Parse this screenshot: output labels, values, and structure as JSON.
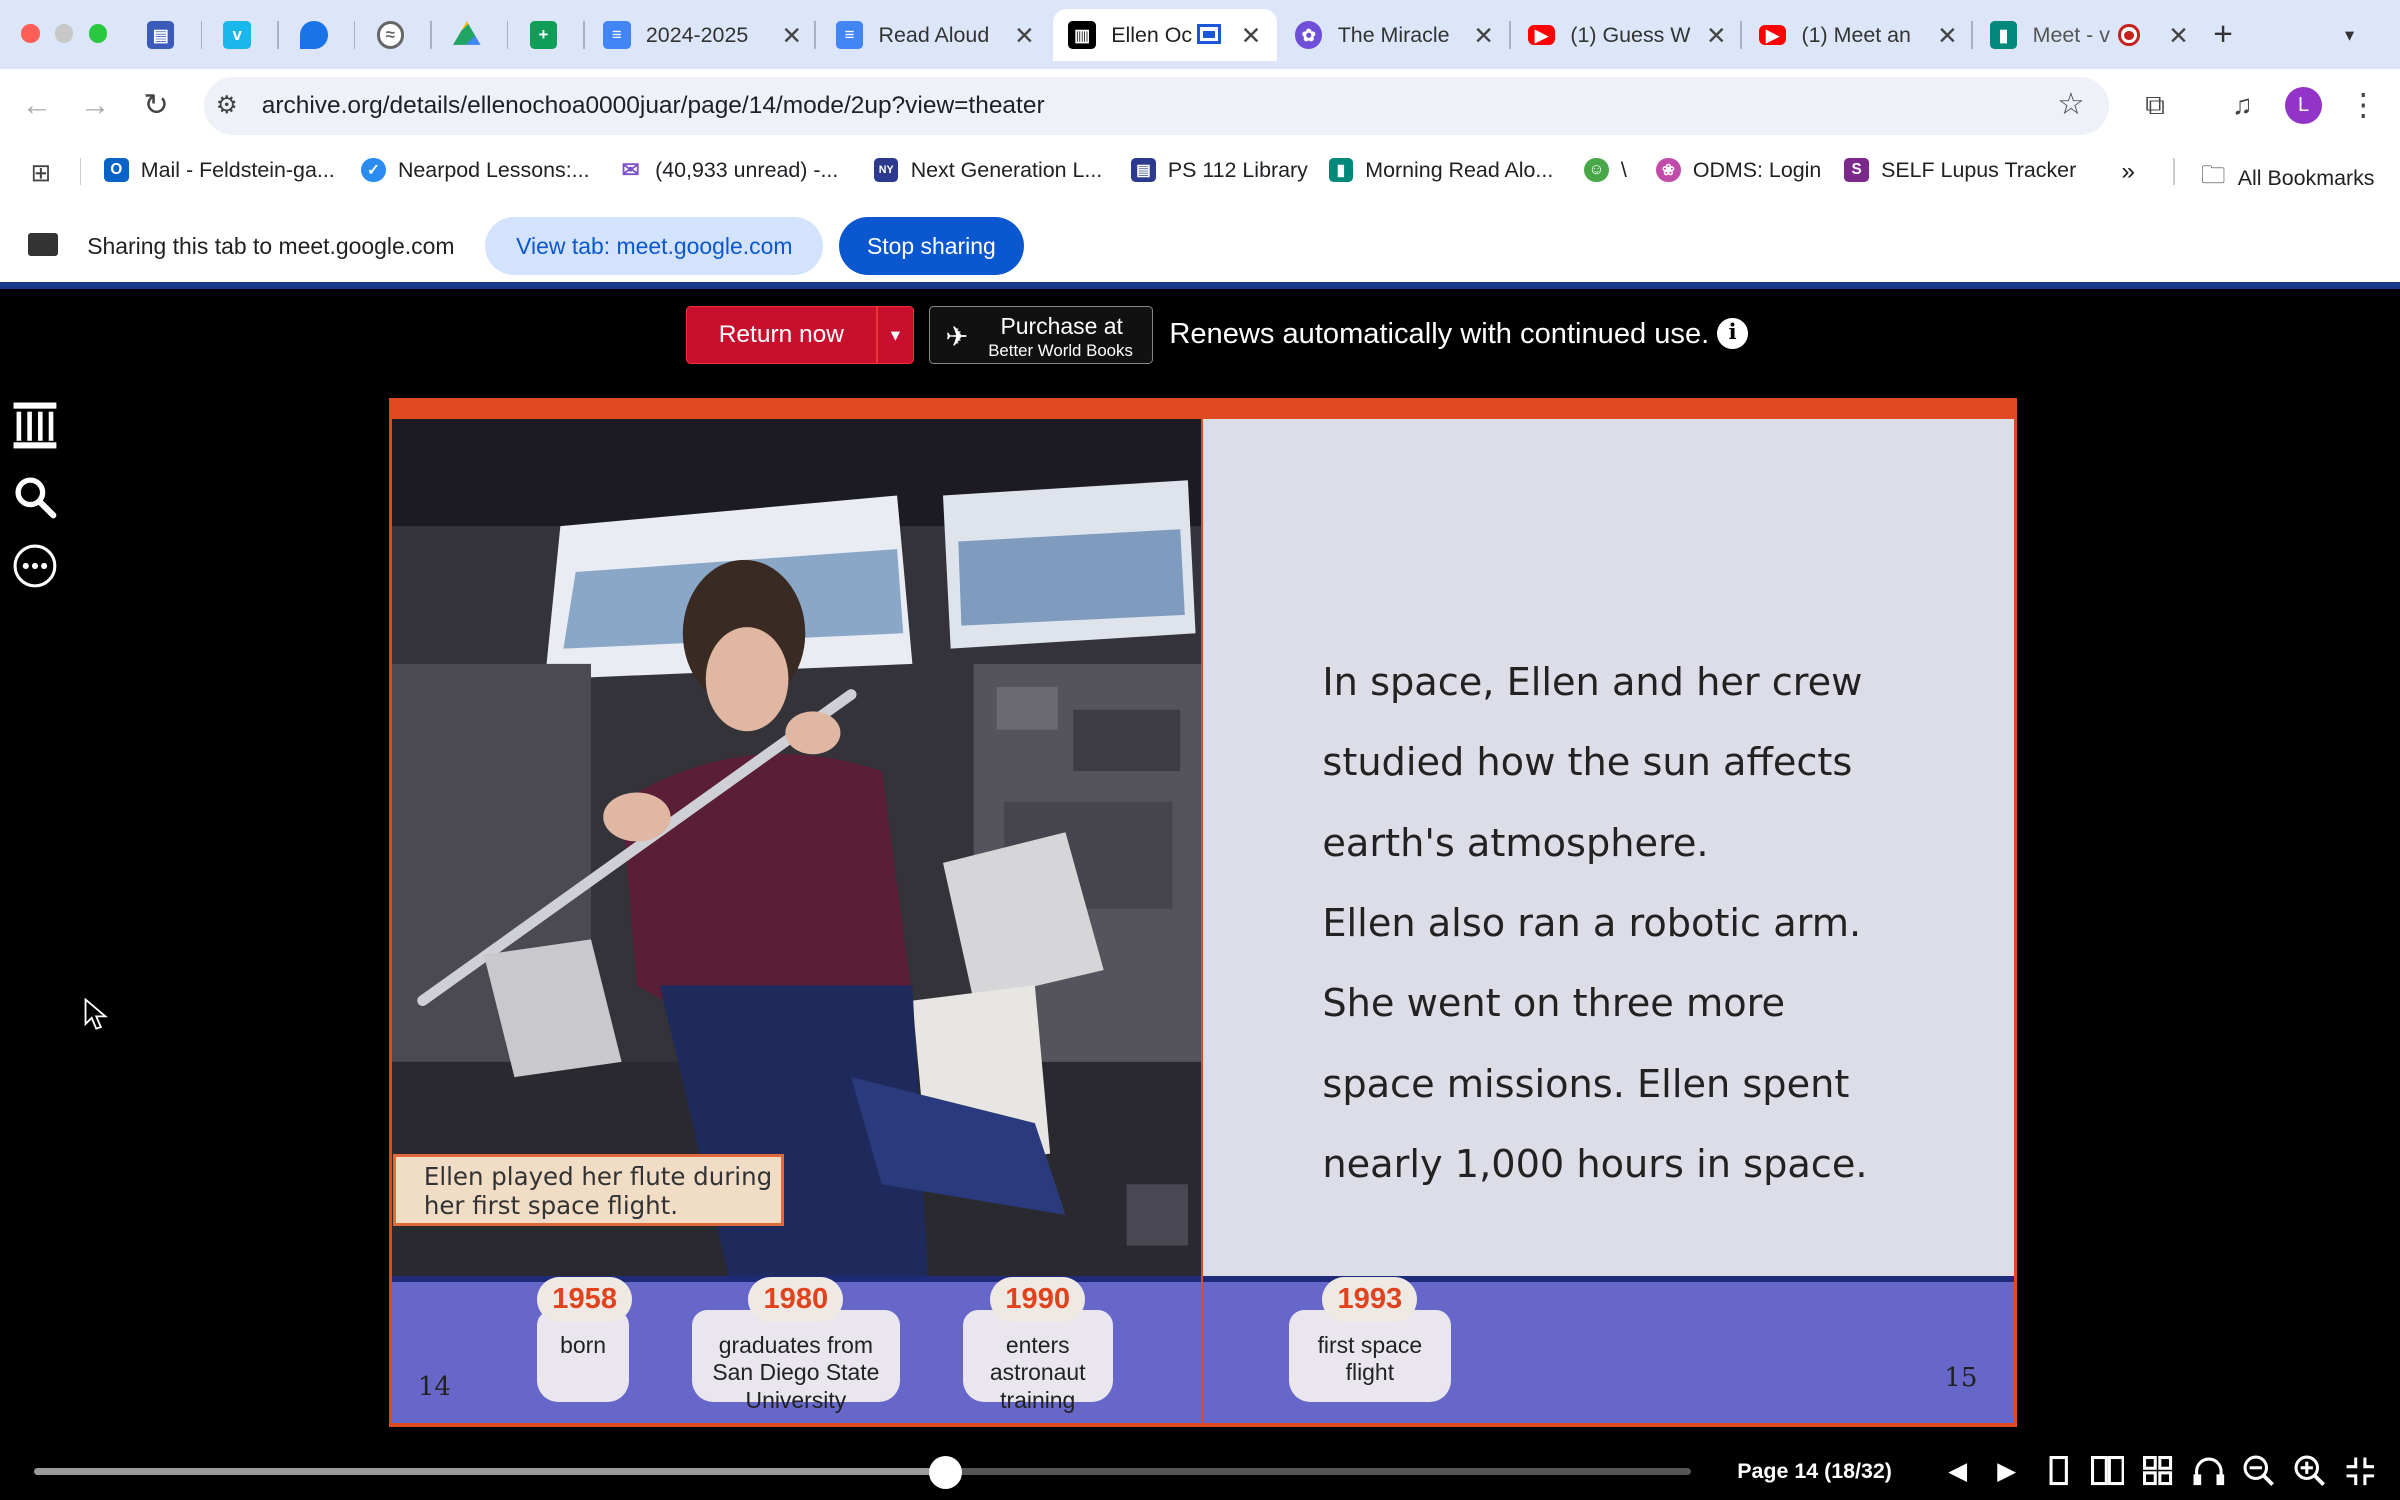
{
  "browser": {
    "tabs": [
      {
        "title": "",
        "icon": "archive-icon",
        "color": "#3a5bb8"
      },
      {
        "title": "",
        "icon": "vimeo-icon",
        "color": "#1ab7ea"
      },
      {
        "title": "",
        "icon": "map-pin-icon",
        "color": "#1a73e8"
      },
      {
        "title": "",
        "icon": "audio-icon",
        "color": "#777777"
      },
      {
        "title": "",
        "icon": "google-drive-icon",
        "color": "#1fa463"
      },
      {
        "title": "",
        "icon": "google-sheets-icon",
        "color": "#0f9d58"
      },
      {
        "title": "2024-2025",
        "icon": "google-docs-icon",
        "color": "#4285f4"
      },
      {
        "title": "Read Aloud",
        "icon": "google-docs-icon",
        "color": "#4285f4"
      },
      {
        "title": "Ellen Oc",
        "icon": "archive-icon",
        "color": "#000000"
      },
      {
        "title": "The Miracle",
        "icon": "extension-icon",
        "color": "#6f4fd8"
      },
      {
        "title": "(1) Guess W",
        "icon": "youtube-icon",
        "color": "#ff0000"
      },
      {
        "title": "(1) Meet an",
        "icon": "youtube-icon",
        "color": "#ff0000"
      },
      {
        "title": "Meet - v",
        "icon": "google-meet-icon",
        "color": "#00897b"
      }
    ],
    "new_tab_label": "+",
    "url": "archive.org/details/ellenochoa0000juar/page/14/mode/2up?view=theater",
    "profile_initial": "L",
    "bookmarks": [
      {
        "label": "Mail - Feldstein-ga...",
        "color": "#0a64c8"
      },
      {
        "label": "Nearpod Lessons:...",
        "color": "#2a8cf0"
      },
      {
        "label": "(40,933 unread) -...",
        "color": "#7d52c8"
      },
      {
        "label": "Next Generation L...",
        "color": "#2b3a8f"
      },
      {
        "label": "PS 112 Library",
        "color": "#2b3a8f"
      },
      {
        "label": "Morning Read Alo...",
        "color": "#00897b"
      },
      {
        "label": "\\",
        "color": "#48a848"
      },
      {
        "label": "ODMS: Login",
        "color": "#c24aa8"
      },
      {
        "label": "SELF Lupus Tracker",
        "color": "#7b2a8c"
      }
    ],
    "all_bookmarks": "All Bookmarks",
    "overflow": "»"
  },
  "share": {
    "message": "Sharing this tab to meet.google.com",
    "view_tab": "View tab: meet.google.com",
    "stop": "Stop sharing"
  },
  "reader": {
    "return_label": "Return now",
    "purchase_line1": "Purchase at",
    "purchase_line2": "Better World Books",
    "renew_text": "Renews automatically with continued use.",
    "info_glyph": "i",
    "page_label": "Page 14 (18/32)",
    "progress": 0.55
  },
  "book": {
    "left_page_number": "14",
    "right_page_number": "15",
    "caption_line1": "Ellen played her flute during",
    "caption_line2": "her first space flight.",
    "text_lines": [
      "In space, Ellen and her crew",
      "studied how the sun affects",
      "earth's atmosphere.",
      "Ellen also ran a robotic arm.",
      "She went on three more",
      "space missions. Ellen spent",
      "nearly 1,000 hours in space."
    ],
    "timeline": [
      {
        "year": "1958",
        "text": "born"
      },
      {
        "year": "1980",
        "text": "graduates from San Diego State University"
      },
      {
        "year": "1990",
        "text": "enters astronaut training"
      },
      {
        "year": "1993",
        "text": "first space flight"
      }
    ]
  }
}
